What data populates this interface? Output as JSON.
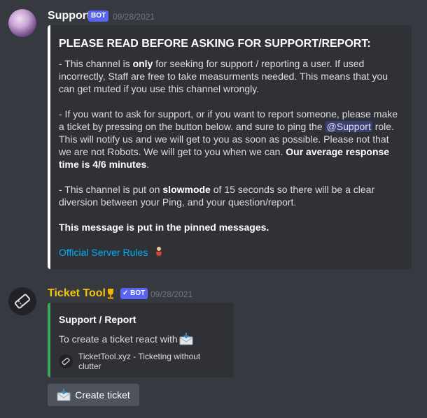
{
  "messages": [
    {
      "author": "Support",
      "author_color": "#ffffff",
      "bot_tag": "BOT",
      "timestamp": "09/28/2021",
      "embed": {
        "title": "PLEASE READ BEFORE ASKING FOR SUPPORT/REPORT:",
        "p1_a": "- This channel is ",
        "p1_bold": "only",
        "p1_b": " for seeking for support / reporting a user. If used incorrectly, Staff are free to take measurments needed. This means that you can get muted if you use this channel wrongly.",
        "p2_a": "- If you want to ask for support, or if you want to report someone, please make a ticket by pressing on the button below. and sure to ping the ",
        "p2_mention": "@Support",
        "p2_b": " role. This will notify us and we will get to you as soon as possible. Please not that we are not Robots. We will get to you when we can. ",
        "p2_bold": "Our average response time is 4/6 minutes",
        "p2_c": ".",
        "p3_a": "- This channel is put on ",
        "p3_bold": "slowmode",
        "p3_b": " of 15 seconds so there will be a clear diversion between your Ping, and your question/report.",
        "p4_bold": "This message is put in the pinned messages.",
        "link": "Official Server Rules"
      }
    },
    {
      "author": "Ticket Tool",
      "author_color": "#f1c40f",
      "bot_tag": "BOT",
      "timestamp": "09/28/2021",
      "embed": {
        "title": "Support / Report",
        "desc": "To create a ticket react with",
        "footer": "TicketTool.xyz - Ticketing without clutter"
      },
      "button_label": "Create ticket"
    }
  ]
}
